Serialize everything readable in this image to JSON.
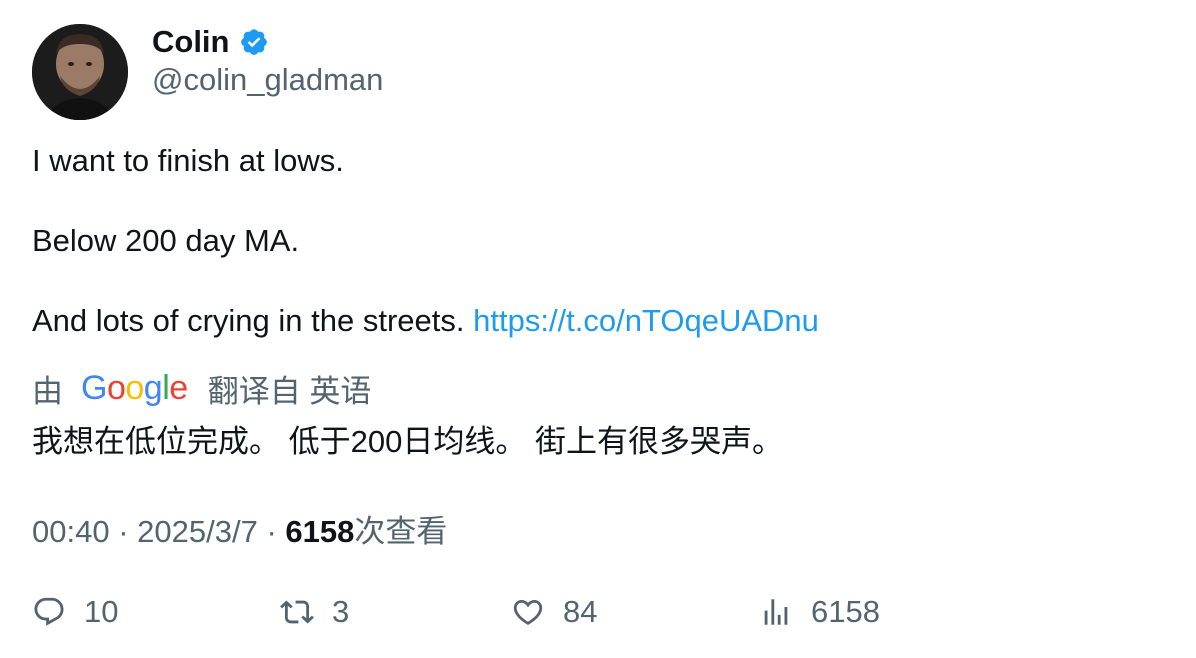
{
  "author": {
    "display_name": "Colin",
    "handle": "@colin_gladman",
    "verified": true
  },
  "tweet": {
    "lines": [
      "I want to finish at lows.",
      "Below 200 day MA.",
      "And lots of crying in the streets."
    ],
    "link": "https://t.co/nTOqeUADnu"
  },
  "translation": {
    "prefix": "由",
    "provider_logo_text": "Google",
    "suffix": "翻译自 英语",
    "text": "我想在低位完成。 低于200日均线。 街上有很多哭声。"
  },
  "meta": {
    "time": "00:40",
    "separator": "·",
    "date": "2025/3/7",
    "views_count": "6158",
    "views_label": "次查看"
  },
  "actions": {
    "replies": "10",
    "retweets": "3",
    "likes": "84",
    "views": "6158"
  },
  "colors": {
    "link": "#1d9bf0",
    "secondary_text": "#536471",
    "primary_text": "#0f1419",
    "verified_badge": "#1d9bf0"
  },
  "icons": {
    "verified": "verified-badge-icon",
    "reply": "reply-icon",
    "retweet": "retweet-icon",
    "like": "heart-icon",
    "views": "analytics-icon"
  }
}
